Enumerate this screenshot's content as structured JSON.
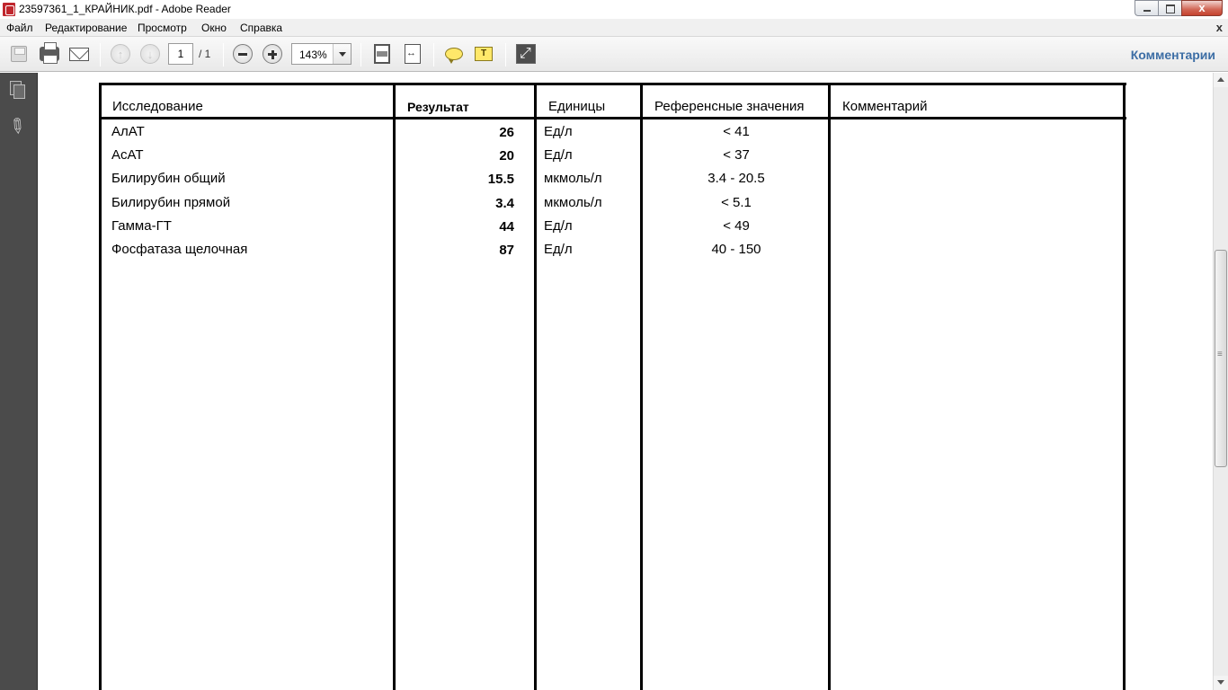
{
  "window": {
    "title": "23597361_1_КРАЙНИК.pdf - Adobe Reader",
    "close_glyph": "x"
  },
  "menu": {
    "items": [
      "Файл",
      "Редактирование",
      "Просмотр",
      "Окно",
      "Справка"
    ],
    "doc_close": "x"
  },
  "toolbar": {
    "page_current": "1",
    "page_total": "/ 1",
    "zoom": "143%",
    "comments_label": "Комментарии",
    "highlight_glyph": "T"
  },
  "icons": {
    "save": "save-icon",
    "print": "printer-icon",
    "email": "envelope-icon",
    "prev_page": "arrow-up-icon",
    "next_page": "arrow-down-icon",
    "zoom_out": "minus-icon",
    "zoom_in": "plus-icon",
    "fit_page": "fit-page-icon",
    "fit_width": "fit-width-icon",
    "comment": "sticky-note-icon",
    "highlight": "highlight-text-icon",
    "expand": "expand-icon",
    "pages_panel": "pages-icon",
    "attachments_panel": "paperclip-icon"
  },
  "table": {
    "headers": [
      "Исследование",
      "Результат",
      "Единицы",
      "Референсные значения",
      "Комментарий"
    ],
    "rows": [
      {
        "test": "АлАТ",
        "result": "26",
        "units": "Ед/л",
        "reference": "< 41",
        "comment": ""
      },
      {
        "test": "АсАТ",
        "result": "20",
        "units": "Ед/л",
        "reference": "< 37",
        "comment": ""
      },
      {
        "test": "Билирубин общий",
        "result": "15.5",
        "units": "мкмоль/л",
        "reference": "3.4 - 20.5",
        "comment": ""
      },
      {
        "test": "Билирубин прямой",
        "result": "3.4",
        "units": "мкмоль/л",
        "reference": "< 5.1",
        "comment": ""
      },
      {
        "test": "Гамма-ГТ",
        "result": "44",
        "units": "Ед/л",
        "reference": "< 49",
        "comment": ""
      },
      {
        "test": "Фосфатаза щелочная",
        "result": "87",
        "units": "Ед/л",
        "reference": "40 - 150",
        "comment": ""
      }
    ]
  },
  "colors": {
    "comments_link": "#3d6ea5",
    "nav_pane": "#4b4b4b",
    "table_rule": "#000000"
  }
}
